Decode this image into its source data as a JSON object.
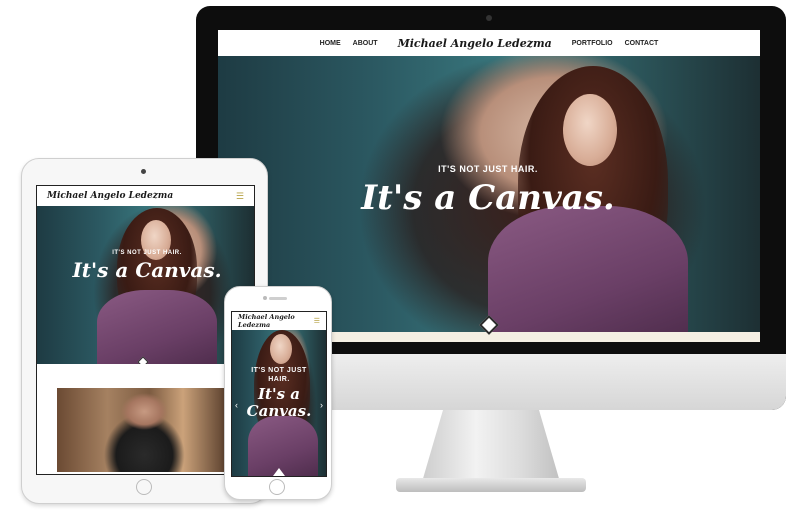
{
  "brand_name": "Michael Angelo Ledezma",
  "nav": {
    "items": [
      "HOME",
      "ABOUT",
      "PORTFOLIO",
      "CONTACT"
    ]
  },
  "hero": {
    "tagline_small": "IT'S NOT JUST HAIR.",
    "tagline_big": "It's a Canvas."
  },
  "phone_hero": {
    "line1": "IT'S NOT JUST",
    "line2": "HAIR.",
    "line3": "It's a",
    "line4": "Canvas."
  },
  "icons": {
    "menu": "hamburger-menu-icon",
    "prev": "chevron-left-icon",
    "next": "chevron-right-icon",
    "scroll": "diamond-down-icon"
  },
  "colors": {
    "accent": "#b8a44a",
    "coat": "#7a4c75",
    "teal_bg": "#2c5a63"
  }
}
